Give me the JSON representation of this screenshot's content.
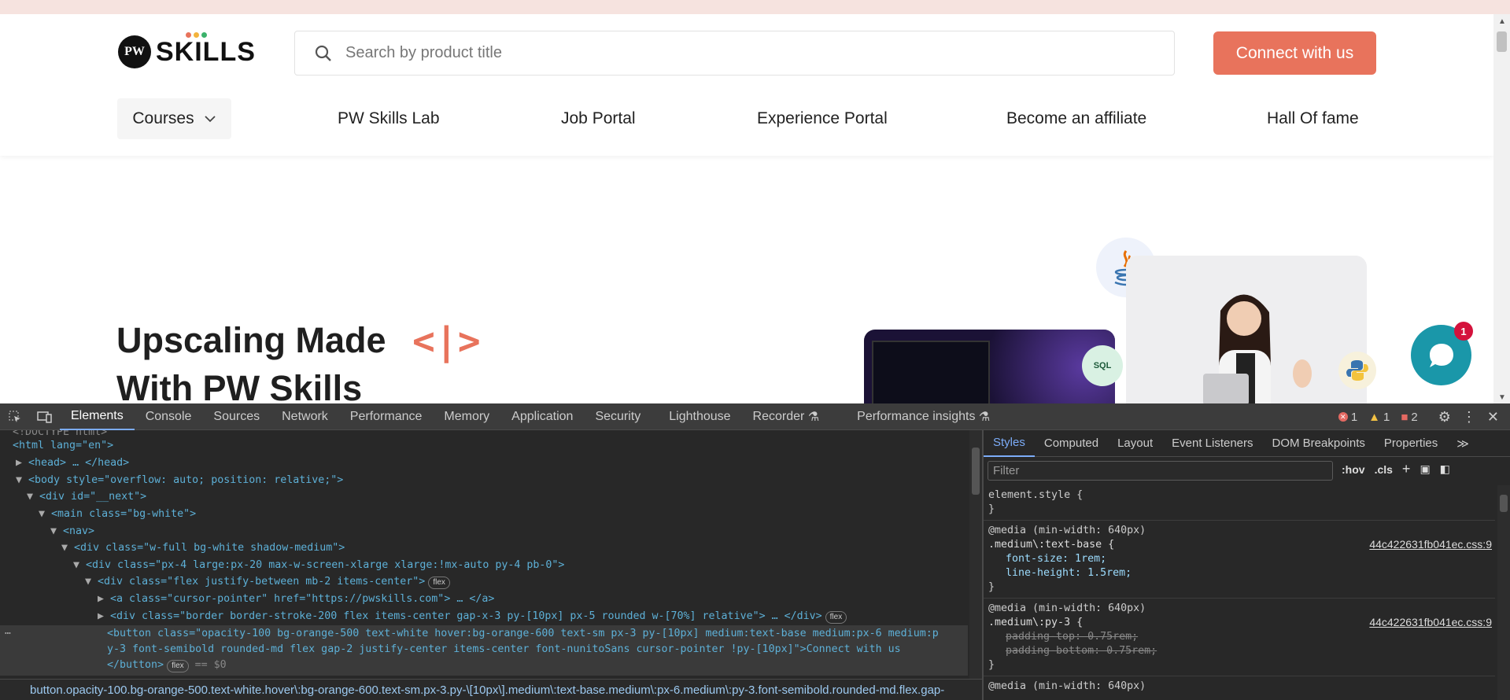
{
  "nav": {
    "logo_badge": "PW",
    "logo_word": "SKILLS",
    "search_placeholder": "Search by product title",
    "cta_label": "Connect with us",
    "menu": [
      "Courses",
      "PW Skills Lab",
      "Job Portal",
      "Experience Portal",
      "Become an affiliate",
      "Hall Of fame"
    ]
  },
  "hero": {
    "title": "Upscaling Made",
    "subtitle": "With PW Skills",
    "brackets": "<|>",
    "sql_badge": "SQL"
  },
  "chat": {
    "notification_count": "1"
  },
  "devtools": {
    "tabs": [
      "Elements",
      "Console",
      "Sources",
      "Network",
      "Performance",
      "Memory",
      "Application",
      "Security",
      "Lighthouse",
      "Recorder",
      "Performance insights"
    ],
    "errors": "1",
    "warnings": "1",
    "issues": "2",
    "dom_lines": [
      "<!DOCTYPE html>",
      "<html lang=\"en\">",
      "<head> … </head>",
      "<body style=\"overflow: auto; position: relative;\">",
      "<div id=\"__next\">",
      "<main class=\"bg-white\">",
      "<nav>",
      "<div class=\"w-full bg-white shadow-medium\">",
      "<div class=\"px-4 large:px-20 max-w-screen-xlarge xlarge:!mx-auto py-4 pb-0\">",
      "<div class=\"flex justify-between mb-2 items-center\">",
      "<a class=\"cursor-pointer\" href=\"https://pwskills.com\"> … </a>",
      "<div class=\"border border-stroke-200 flex items-center gap-x-3 py-[10px] px-5 rounded w-[70%] relative\"> … </div>",
      "<button class=\"opacity-100 bg-orange-500 text-white hover:bg-orange-600 text-sm px-3 py-[10px] medium:text-base medium:px-6 medium:p",
      "y-3 font-semibold rounded-md flex gap-2 justify-center items-center font-nunitoSans cursor-pointer !py-[10px]\">Connect with us",
      "</button>"
    ],
    "pill_flex": "flex",
    "selected_marker": "== $0",
    "breadcrumb": "button.opacity-100.bg-orange-500.text-white.hover\\:bg-orange-600.text-sm.px-3.py-\\[10px\\].medium\\:text-base.medium\\:px-6.medium\\:py-3.font-semibold.rounded-md.flex.gap-",
    "styles_tabs": [
      "Styles",
      "Computed",
      "Layout",
      "Event Listeners",
      "DOM Breakpoints",
      "Properties"
    ],
    "filter_placeholder": "Filter",
    "hov": ":hov",
    "cls": ".cls",
    "rules": {
      "element_style": "element.style {",
      "close": "}",
      "media": "@media (min-width: 640px)",
      "r1_selector": ".medium\\:text-base {",
      "r1_src": "44c422631fb041ec.css:9",
      "r1_p1": "font-size: 1rem;",
      "r1_p2": "line-height: 1.5rem;",
      "r2_selector": ".medium\\:py-3 {",
      "r2_src": "44c422631fb041ec.css:9",
      "r2_p1": "padding-top: 0.75rem;",
      "r2_p2": "padding-bottom: 0.75rem;",
      "r3_media": "@media (min-width: 640px)"
    }
  }
}
